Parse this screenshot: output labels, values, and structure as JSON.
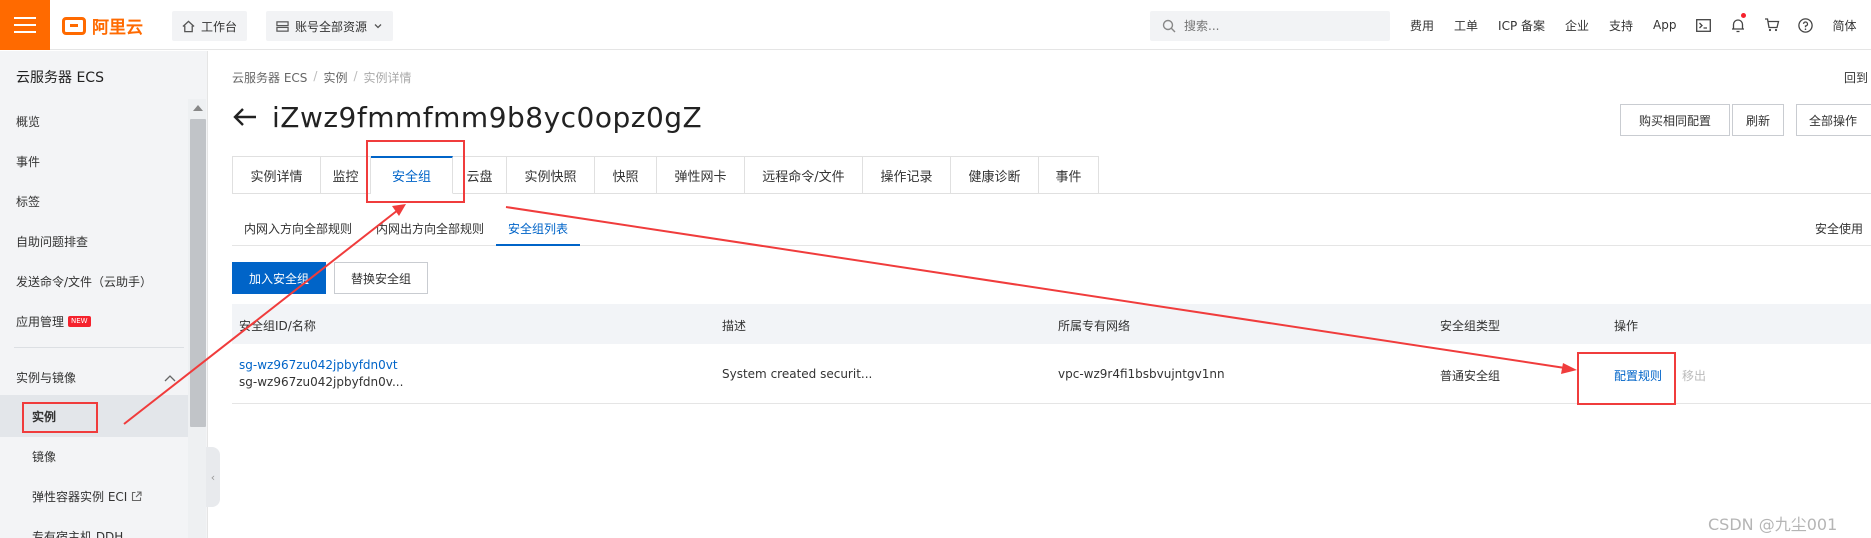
{
  "topbar": {
    "logo_text": "阿里云",
    "workbench_label": "工作台",
    "account_resources_label": "账号全部资源",
    "search_placeholder": "搜索...",
    "links": [
      "费用",
      "工单",
      "ICP 备案",
      "企业",
      "支持",
      "App"
    ],
    "language_label": "简体",
    "accent_color": "#ff6a00"
  },
  "sidebar": {
    "title": "云服务器 ECS",
    "items": [
      {
        "label": "概览"
      },
      {
        "label": "事件"
      },
      {
        "label": "标签"
      },
      {
        "label": "自助问题排查"
      },
      {
        "label": "发送命令/文件（云助手）"
      },
      {
        "label": "应用管理",
        "badge": "NEW"
      }
    ],
    "group_label": "实例与镜像",
    "sub_items": [
      {
        "label": "实例"
      },
      {
        "label": "镜像"
      },
      {
        "label": "弹性容器实例 ECI"
      },
      {
        "label": "专有宿主机 DDH"
      }
    ]
  },
  "breadcrumb": {
    "items": [
      "云服务器 ECS",
      "实例",
      "实例详情"
    ],
    "back_link": "回到"
  },
  "header": {
    "title": "iZwz9fmmfmm9b8yc0opz0gZ",
    "buttons": [
      "购买相同配置",
      "刷新",
      "全部操作"
    ]
  },
  "tabs": [
    "实例详情",
    "监控",
    "安全组",
    "云盘",
    "实例快照",
    "快照",
    "弹性网卡",
    "远程命令/文件",
    "操作记录",
    "健康诊断",
    "事件"
  ],
  "subtabs": [
    "内网入方向全部规则",
    "内网出方向全部规则",
    "安全组列表"
  ],
  "subtab_right": "安全使用",
  "actions": {
    "join_label": "加入安全组",
    "replace_label": "替换安全组"
  },
  "table": {
    "columns": [
      "安全组ID/名称",
      "描述",
      "所属专有网络",
      "安全组类型",
      "操作"
    ],
    "rows": [
      {
        "id": "sg-wz967zu042jpbyfdn0vt",
        "name": "sg-wz967zu042jpbyfdn0v...",
        "description": "System created securit...",
        "vpc": "vpc-wz9r4fi1bsbvujntgv1nn",
        "type": "普通安全组",
        "action_config": "配置规则",
        "action_remove": "移出"
      }
    ]
  },
  "watermark": "CSDN @九尘001",
  "annotation_color": "#f03c3c"
}
